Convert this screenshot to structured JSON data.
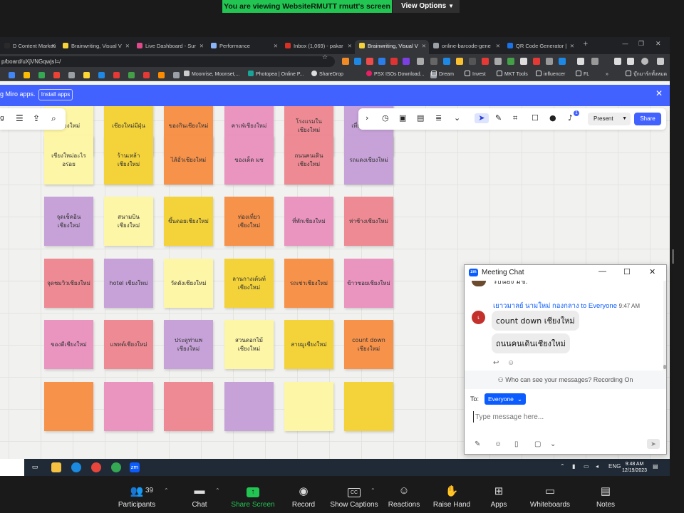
{
  "zoom_top": {
    "viewing_text": "You are viewing WebsiteRMUTT rmutt's screen",
    "view_options_label": "View Options"
  },
  "browser": {
    "tabs": [
      {
        "label": "D Content Marketi",
        "color": "#2a2a2a"
      },
      {
        "label": "Brainwriting, Visual V",
        "color": "#f4d33a"
      },
      {
        "label": "Live Dashboard - Sur",
        "color": "#e04a8a"
      },
      {
        "label": "Performance",
        "color": "#8ab4f8"
      },
      {
        "label": "Inbox (1,069) - pakar",
        "color": "#d93025"
      },
      {
        "label": "Brainwriting, Visual V",
        "color": "#f4d33a"
      },
      {
        "label": "online-barcode-gene",
        "color": "#9aa0a6"
      },
      {
        "label": "QR Code Generator |",
        "color": "#1a73e8"
      }
    ],
    "url": "p/board/uXjVNGqwjsI=/",
    "bookmarks": [
      "Moonrise, Moonset,...",
      "Photopea | Online P...",
      "ShareDrop",
      "PSX ISOs Download...",
      "Dream",
      "Invest",
      "MKT Tools",
      "influencer",
      "FL",
      "บุ๊กมาร์กทั้งหมด"
    ]
  },
  "miro": {
    "banner_text": "g Miro apps.",
    "install_label": "Install apps",
    "present_label": "Present",
    "share_label": "Share",
    "notification_count": "1",
    "notes": [
      {
        "text": "เชียงใหม่",
        "color": "yellow-pale"
      },
      {
        "text": "เชียงใหม่มีฝุ่น",
        "color": "yellow"
      },
      {
        "text": "ของกินเชียงใหม่",
        "color": "orange"
      },
      {
        "text": "คาเฟ่เชียงใหม่",
        "color": "pink"
      },
      {
        "text": "โรงแรมในเชียงใหม่",
        "color": "rose"
      },
      {
        "text": "เที่ยวเชียงใหม่",
        "color": "purple"
      },
      {
        "text": "เชียงใหม่อะไรอร่อย",
        "color": "yellow-pale"
      },
      {
        "text": "ร้านเหล้าเชียงใหม่",
        "color": "yellow"
      },
      {
        "text": "ไส้อั่วเชียงใหม่",
        "color": "orange"
      },
      {
        "text": "ของเด็ด มช",
        "color": "pink"
      },
      {
        "text": "ถนนคนเดินเชียงใหม่",
        "color": "rose"
      },
      {
        "text": "รถแดงเชียงใหม่",
        "color": "purple"
      },
      {
        "text": "จุดเช็คอินเชียงใหม่",
        "color": "purple"
      },
      {
        "text": "สนามบินเชียงใหม่",
        "color": "yellow-pale"
      },
      {
        "text": "ขึ้นดอยเชียงใหม่",
        "color": "yellow"
      },
      {
        "text": "ท่องเที่ยวเชียงใหม่",
        "color": "orange"
      },
      {
        "text": "ที่พักเชียงใหม่",
        "color": "pink"
      },
      {
        "text": "ห่าช้างเชียงใหม่",
        "color": "rose"
      },
      {
        "text": "จุดชมวิวเชียงใหม่",
        "color": "rose"
      },
      {
        "text": "hotel เชียงใหม่",
        "color": "purple"
      },
      {
        "text": "วัดดังเชียงใหม่",
        "color": "yellow-pale"
      },
      {
        "text": "ลานกางเต้นท์เชียงใหม่",
        "color": "yellow"
      },
      {
        "text": "รถเช่าเชียงใหม่",
        "color": "orange"
      },
      {
        "text": "ข้าวซอยเชียงใหม่",
        "color": "pink"
      },
      {
        "text": "ของดีเชียงใหม่",
        "color": "pink"
      },
      {
        "text": "แพทต์เชียงใหม่",
        "color": "rose"
      },
      {
        "text": "ประตูท่าแพเชียงใหม่",
        "color": "purple"
      },
      {
        "text": "สวนดอกไม้เชียงใหม่",
        "color": "yellow-pale"
      },
      {
        "text": "สายมูเชียงใหม่",
        "color": "yellow"
      },
      {
        "text": "count down เชียงใหม่",
        "color": "orange"
      },
      {
        "text": "",
        "color": "orange"
      },
      {
        "text": "",
        "color": "pink"
      },
      {
        "text": "",
        "color": "rose"
      },
      {
        "text": "",
        "color": "purple"
      },
      {
        "text": "",
        "color": "yellow-pale"
      },
      {
        "text": "",
        "color": "yellow"
      }
    ]
  },
  "chat": {
    "title": "Meeting Chat",
    "logo_text": "zm",
    "clipped_message": "รบนอง มช.",
    "sender_name": "เยาวมาลย์ นามใหม่ กองกลาง",
    "sender_to": "to Everyone",
    "sender_time": "9:47 AM",
    "avatar_initial": "เ",
    "messages": [
      "count down เชียงใหม่",
      "ถนนคนเดินเชียงใหม่"
    ],
    "privacy_note": "Who can see your messages? Recording On",
    "to_label": "To:",
    "recipient": "Everyone",
    "input_placeholder": "Type message here..."
  },
  "taskbar": {
    "lang": "ENG",
    "time": "9:48 AM",
    "date": "12/19/2023"
  },
  "zoom_bottom": {
    "participants_label": "Participants",
    "participants_count": "39",
    "chat_label": "Chat",
    "share_label": "Share Screen",
    "record_label": "Record",
    "captions_label": "Show Captions",
    "cc_text": "CC",
    "reactions_label": "Reactions",
    "raise_hand_label": "Raise Hand",
    "apps_label": "Apps",
    "whiteboards_label": "Whiteboards",
    "notes_label": "Notes"
  }
}
